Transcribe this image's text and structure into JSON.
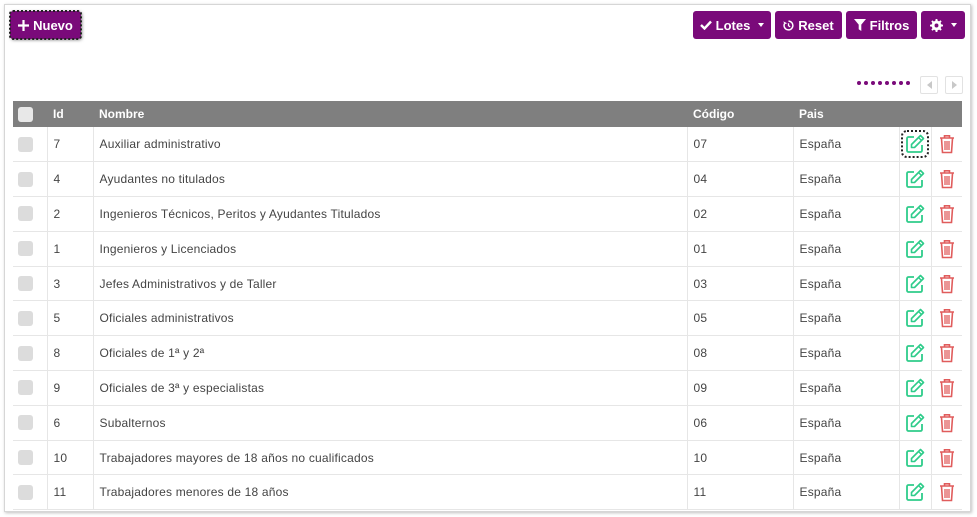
{
  "toolbar": {
    "new_label": "Nuevo",
    "lotes_label": "Lotes",
    "reset_label": "Reset",
    "filters_label": "Filtros"
  },
  "colors": {
    "primary": "#7a0a7a",
    "header_bg": "#7f7f7f",
    "edit_icon": "#2ecc8a",
    "delete_icon": "#e05c5c"
  },
  "table": {
    "columns": [
      "Id",
      "Nombre",
      "Código",
      "Pais"
    ],
    "rows": [
      {
        "id": "7",
        "nombre": "Auxiliar administrativo",
        "codigo": "07",
        "pais": "España"
      },
      {
        "id": "4",
        "nombre": "Ayudantes no titulados",
        "codigo": "04",
        "pais": "España"
      },
      {
        "id": "2",
        "nombre": "Ingenieros Técnicos, Peritos y Ayudantes Titulados",
        "codigo": "02",
        "pais": "España"
      },
      {
        "id": "1",
        "nombre": "Ingenieros y Licenciados",
        "codigo": "01",
        "pais": "España"
      },
      {
        "id": "3",
        "nombre": "Jefes Administrativos y de Taller",
        "codigo": "03",
        "pais": "España"
      },
      {
        "id": "5",
        "nombre": "Oficiales administrativos",
        "codigo": "05",
        "pais": "España"
      },
      {
        "id": "8",
        "nombre": "Oficiales de 1ª y 2ª",
        "codigo": "08",
        "pais": "España"
      },
      {
        "id": "9",
        "nombre": "Oficiales de 3ª y especialistas",
        "codigo": "09",
        "pais": "España"
      },
      {
        "id": "6",
        "nombre": "Subalternos",
        "codigo": "06",
        "pais": "España"
      },
      {
        "id": "10",
        "nombre": "Trabajadores mayores de 18 años no cualificados",
        "codigo": "10",
        "pais": "España"
      },
      {
        "id": "11",
        "nombre": "Trabajadores menores de 18 años",
        "codigo": "11",
        "pais": "España"
      }
    ]
  },
  "icons": {
    "new": "plus-icon",
    "lotes": "check-icon",
    "reset": "history-icon",
    "filters": "funnel-icon",
    "settings": "gear-icon",
    "edit": "pencil-square-icon",
    "delete": "trash-icon"
  }
}
